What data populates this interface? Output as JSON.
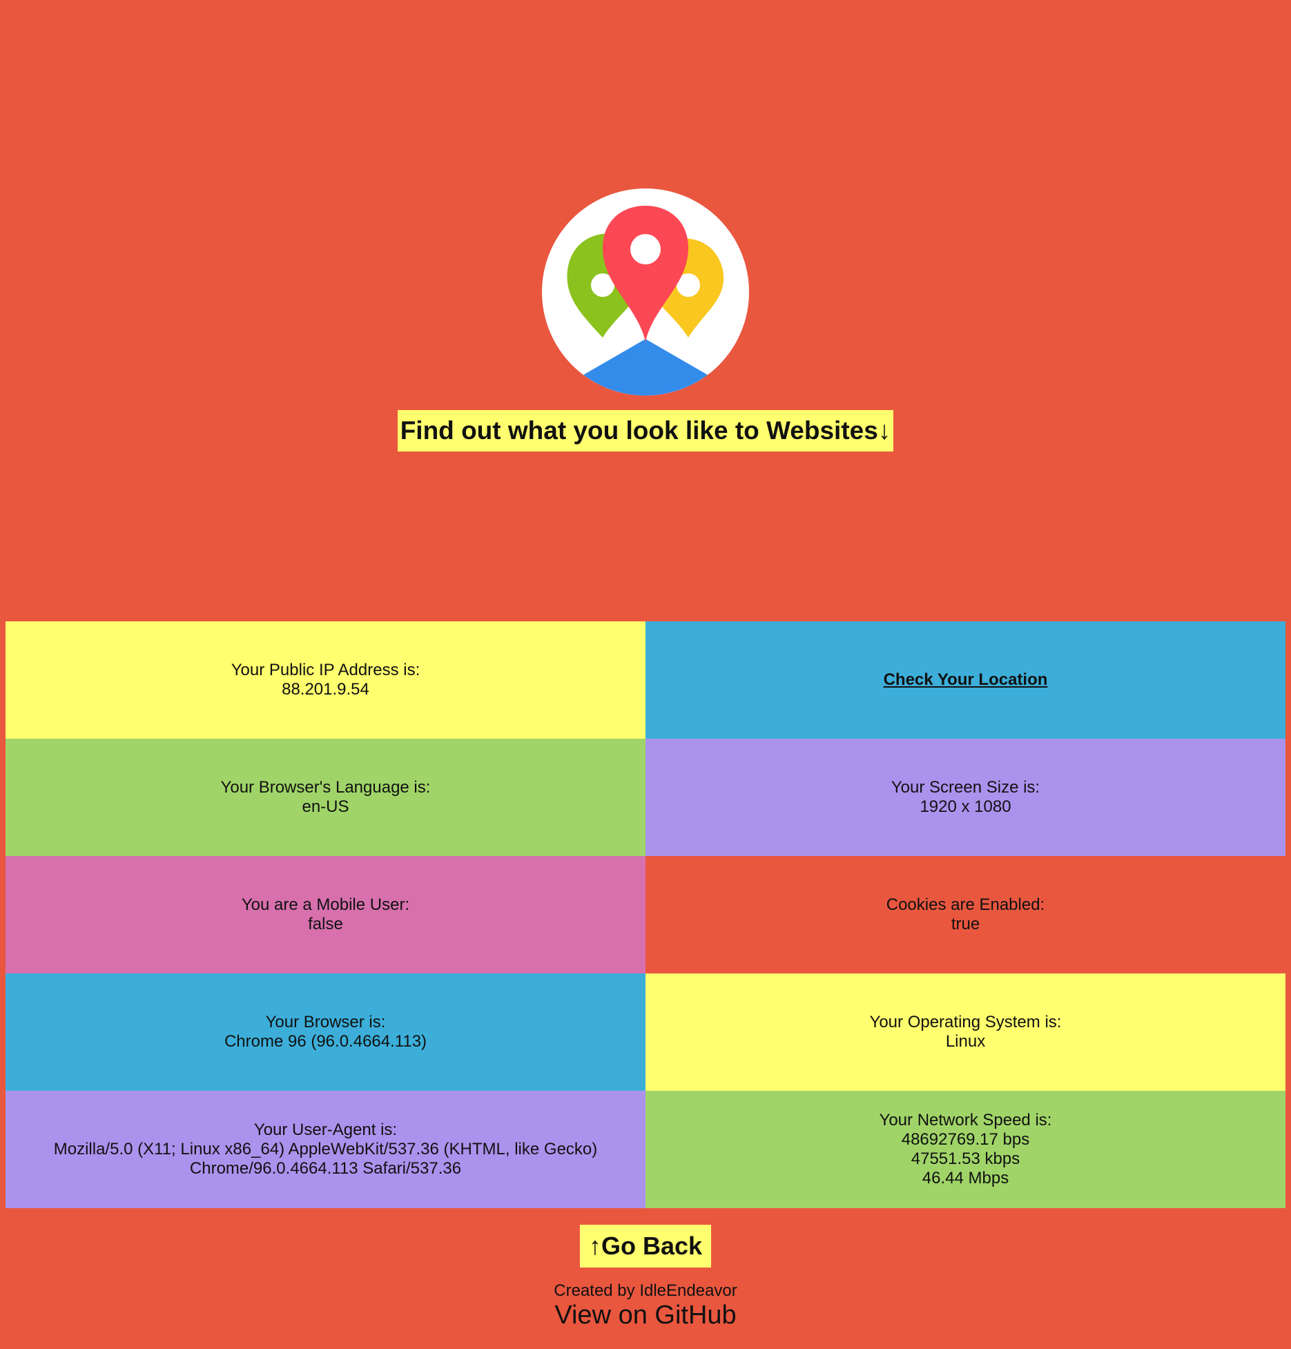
{
  "colors": {
    "page_background": "#e9573f",
    "tagline_background": "#ffff6f",
    "pin_red": "#fc4754",
    "pin_green": "#8cc21e",
    "pin_yellow": "#f9c71f",
    "ground_blue": "#338cea"
  },
  "hero": {
    "logo_icon": "map-pins-icon",
    "tagline": "Find out what you look like to Websites",
    "tagline_arrow": "↓"
  },
  "cells": [
    {
      "label": "Your Public IP Address is:",
      "value_lines": [
        "88.201.9.54"
      ],
      "color": "#ffff6f"
    },
    {
      "link": "Check Your Location",
      "color": "#3caed9"
    },
    {
      "label": "Your Browser's Language is:",
      "value_lines": [
        "en-US"
      ],
      "color": "#a0d468"
    },
    {
      "label": "Your Screen Size is:",
      "value_lines": [
        "1920 x 1080"
      ],
      "color": "#ab92ed"
    },
    {
      "label": "You are a Mobile User:",
      "value_lines": [
        "false"
      ],
      "color": "#d770ad"
    },
    {
      "label": "Cookies are Enabled:",
      "value_lines": [
        "true"
      ],
      "color": "#e9573f"
    },
    {
      "label": "Your Browser is:",
      "value_lines": [
        "Chrome 96 (96.0.4664.113)"
      ],
      "color": "#3caed9"
    },
    {
      "label": "Your Operating System is:",
      "value_lines": [
        "Linux"
      ],
      "color": "#ffff6f"
    },
    {
      "label": "Your User-Agent is:",
      "value_lines": [
        "Mozilla/5.0 (X11; Linux x86_64) AppleWebKit/537.36 (KHTML, like Gecko)",
        "Chrome/96.0.4664.113 Safari/537.36"
      ],
      "color": "#ab92ed"
    },
    {
      "label": "Your Network Speed is:",
      "value_lines": [
        "48692769.17 bps",
        "47551.53 kbps",
        "46.44 Mbps"
      ],
      "color": "#a0d468"
    }
  ],
  "footer": {
    "go_back_arrow": "↑",
    "go_back_label": "Go Back",
    "credit": "Created by IdleEndeavor",
    "github_link": "View on GitHub"
  }
}
